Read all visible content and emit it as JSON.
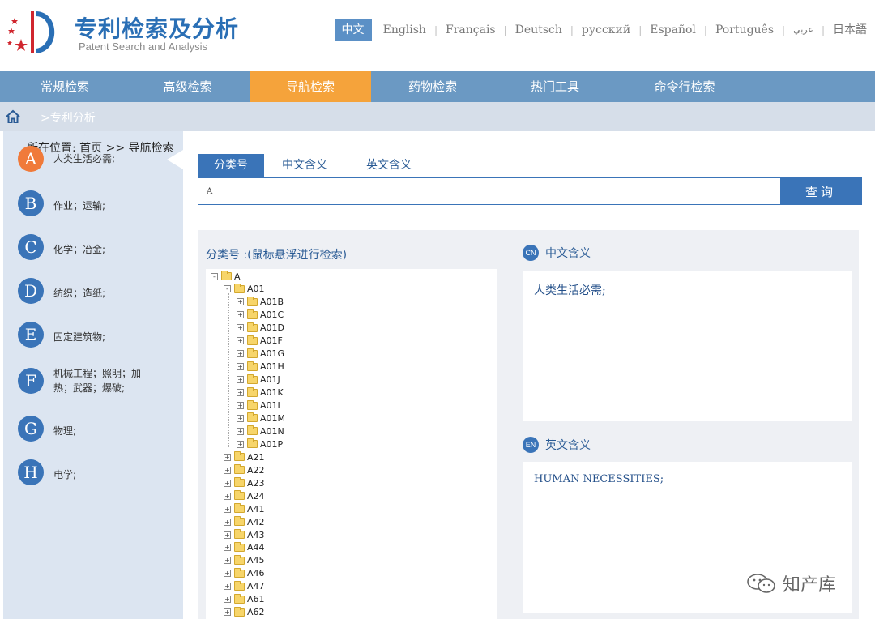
{
  "header": {
    "title": "专利检索及分析",
    "subtitle": "Patent Search and Analysis"
  },
  "languages": [
    {
      "label": "中文",
      "active": true
    },
    {
      "label": "English"
    },
    {
      "label": "Français"
    },
    {
      "label": "Deutsch"
    },
    {
      "label": "русский"
    },
    {
      "label": "Español"
    },
    {
      "label": "Português"
    },
    {
      "label": "عربي"
    },
    {
      "label": "日本語"
    }
  ],
  "nav": [
    {
      "label": "常规检索"
    },
    {
      "label": "高级检索"
    },
    {
      "label": "导航检索",
      "active": true
    },
    {
      "label": "药物检索"
    },
    {
      "label": "热门工具"
    },
    {
      "label": "命令行检索"
    }
  ],
  "breadcrumb_bar": {
    "link": ">专利分析"
  },
  "location": "所在位置: 首页 >> 导航检索",
  "categories": [
    {
      "letter": "A",
      "label": "人类生活必需;",
      "active": true
    },
    {
      "letter": "B",
      "label": "作业；运输;"
    },
    {
      "letter": "C",
      "label": "化学；冶金;"
    },
    {
      "letter": "D",
      "label": "纺织；造纸;"
    },
    {
      "letter": "E",
      "label": "固定建筑物;"
    },
    {
      "letter": "F",
      "label": "机械工程；照明；加热；武器；爆破;"
    },
    {
      "letter": "G",
      "label": "物理;"
    },
    {
      "letter": "H",
      "label": "电学;"
    }
  ],
  "search": {
    "tabs": [
      "分类号",
      "中文含义",
      "英文含义"
    ],
    "active_tab": 0,
    "value": "A",
    "button": "查询"
  },
  "tree": {
    "heading": "分类号 :(鼠标悬浮进行检索)",
    "root": "A",
    "level1_open": "A01",
    "level2": [
      "A01B",
      "A01C",
      "A01D",
      "A01F",
      "A01G",
      "A01H",
      "A01J",
      "A01K",
      "A01L",
      "A01M",
      "A01N",
      "A01P"
    ],
    "level1_closed": [
      "A21",
      "A22",
      "A23",
      "A24",
      "A41",
      "A42",
      "A43",
      "A44",
      "A45",
      "A46",
      "A47",
      "A61",
      "A62"
    ]
  },
  "meaning": {
    "cn_badge": "CN",
    "cn_title": "中文含义",
    "cn_text": "人类生活必需;",
    "en_badge": "EN",
    "en_title": "英文含义",
    "en_text": "HUMAN NECESSITIES;"
  },
  "watermark": "知产库"
}
